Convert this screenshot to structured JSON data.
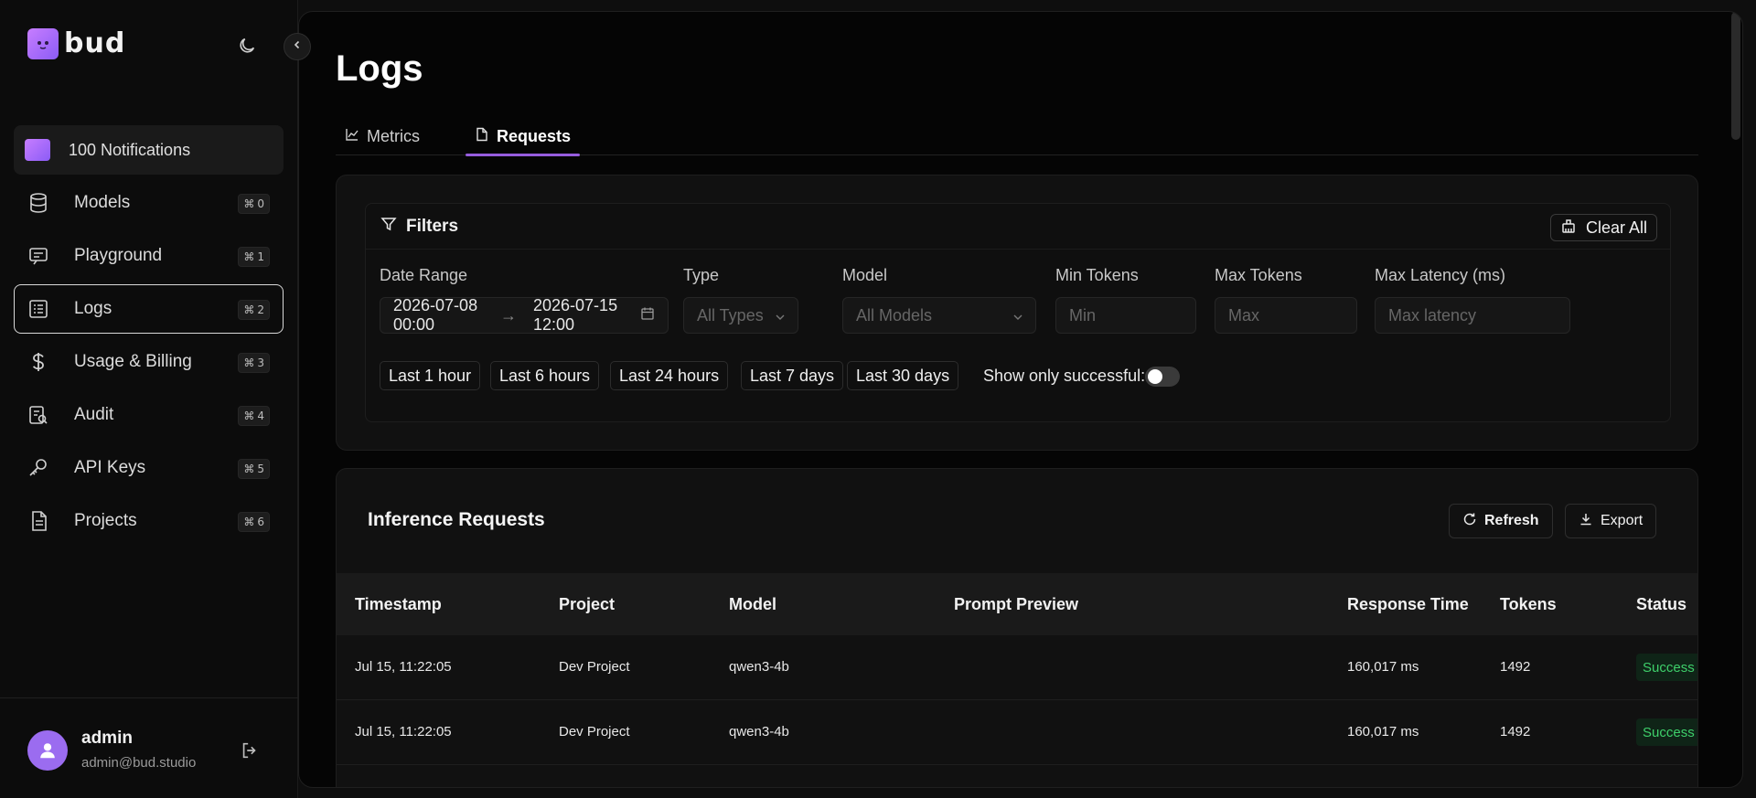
{
  "brand": {
    "name": "bud"
  },
  "sidebar": {
    "notifications": {
      "label": "100 Notifications"
    },
    "items": [
      {
        "label": "Models",
        "shortcut": "0",
        "icon": "database-icon"
      },
      {
        "label": "Playground",
        "shortcut": "1",
        "icon": "playground-icon"
      },
      {
        "label": "Logs",
        "shortcut": "2",
        "icon": "logs-icon",
        "active": true
      },
      {
        "label": "Usage & Billing",
        "shortcut": "3",
        "icon": "dollar-icon"
      },
      {
        "label": "Audit",
        "shortcut": "4",
        "icon": "audit-icon"
      },
      {
        "label": "API Keys",
        "shortcut": "5",
        "icon": "key-icon"
      },
      {
        "label": "Projects",
        "shortcut": "6",
        "icon": "document-icon"
      }
    ],
    "shortcut_symbol": "⌘"
  },
  "user": {
    "name": "admin",
    "email": "admin@bud.studio"
  },
  "page": {
    "title": "Logs"
  },
  "tabs": [
    {
      "label": "Metrics",
      "icon": "chart-line-icon"
    },
    {
      "label": "Requests",
      "icon": "folder-icon",
      "active": true
    }
  ],
  "filters": {
    "title": "Filters",
    "clear_label": "Clear All",
    "date_range": {
      "label": "Date Range",
      "start": "2026-07-08 00:00",
      "end": "2026-07-15 12:00"
    },
    "type": {
      "label": "Type",
      "value": "All Types"
    },
    "model": {
      "label": "Model",
      "value": "All Models"
    },
    "min_tokens": {
      "label": "Min Tokens",
      "placeholder": "Min"
    },
    "max_tokens": {
      "label": "Max Tokens",
      "placeholder": "Max"
    },
    "max_latency": {
      "label": "Max Latency (ms)",
      "placeholder": "Max latency"
    },
    "quick_ranges": [
      "Last 1 hour",
      "Last 6 hours",
      "Last 24 hours",
      "Last 7 days",
      "Last 30 days"
    ],
    "success_toggle": {
      "label": "Show only successful:",
      "on": false
    }
  },
  "requests": {
    "title": "Inference Requests",
    "refresh_label": "Refresh",
    "export_label": "Export",
    "columns": [
      "Timestamp",
      "Project",
      "Model",
      "Prompt Preview",
      "Response Time",
      "Tokens",
      "Status"
    ],
    "rows": [
      {
        "timestamp": "Jul 15, 11:22:05",
        "project": "Dev Project",
        "model": "qwen3-4b",
        "prompt": "",
        "response_time": "160,017 ms",
        "tokens": "1492",
        "status": "Success"
      },
      {
        "timestamp": "Jul 15, 11:22:05",
        "project": "Dev Project",
        "model": "qwen3-4b",
        "prompt": "",
        "response_time": "160,017 ms",
        "tokens": "1492",
        "status": "Success"
      }
    ]
  },
  "colors": {
    "accent": "#965cde",
    "success": "#3ecf6a"
  }
}
